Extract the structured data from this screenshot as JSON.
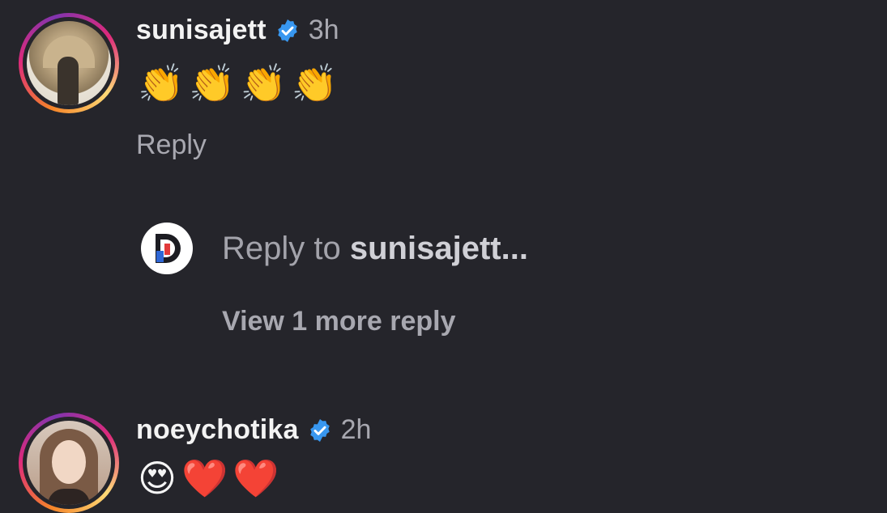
{
  "comments": [
    {
      "username": "sunisajett",
      "verified": true,
      "time": "3h",
      "text": "👏👏👏👏",
      "reply_label": "Reply"
    },
    {
      "username": "noeychotika",
      "verified": true,
      "time": "2h",
      "text": "😍❤️❤️"
    }
  ],
  "reply_input": {
    "prefix": "Reply to",
    "target": "sunisajett..."
  },
  "view_more": "View 1 more reply",
  "colors": {
    "background": "#25252b",
    "verified": "#3897f0",
    "muted_text": "#a8a8b0"
  },
  "icons": {
    "verified": "verified-badge-icon",
    "avatar_ring": "story-ring"
  }
}
